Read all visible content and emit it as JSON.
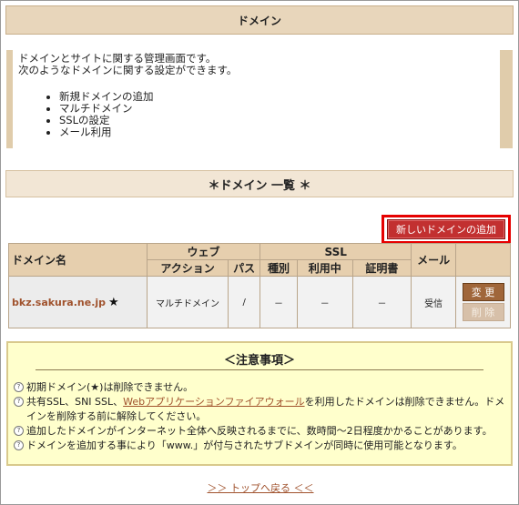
{
  "header": {
    "title": "ドメイン"
  },
  "intro": {
    "lines": [
      "ドメインとサイトに関する管理画面です。",
      "次のようなドメインに関する設定ができます。"
    ],
    "items": [
      "新規ドメインの追加",
      "マルチドメイン",
      "SSLの設定",
      "メール利用"
    ]
  },
  "list": {
    "heading": "＊ドメイン 一覧 ＊",
    "add_button": "新しいドメインの追加",
    "columns": {
      "domain": "ドメイン名",
      "web": "ウェブ",
      "action": "アクション",
      "path": "パス",
      "ssl": "SSL",
      "type": "種別",
      "in_use": "利用中",
      "cert": "証明書",
      "mail": "メール"
    },
    "rows": [
      {
        "domain": "bkz.sakura.ne.jp",
        "star": "★",
        "action": "マルチドメイン",
        "path": "/",
        "type": "－",
        "in_use": "－",
        "cert": "－",
        "mail": "受信",
        "change": "変 更",
        "delete": "削 除"
      }
    ]
  },
  "notes": {
    "title": "＜注意事項＞",
    "items": [
      {
        "text": "初期ドメイン(★)は削除できません。"
      },
      {
        "pre": "共有SSL、SNI SSL、",
        "link": "Webアプリケーションファイアウォール",
        "post": "を利用したドメインは削除できません。ドメインを削除する前に解除してください。"
      },
      {
        "text": "追加したドメインがインターネット全体へ反映されるまでに、数時間～2日程度かかることがあります。"
      },
      {
        "text": "ドメインを追加する事により「www.」が付与されたサブドメインが同時に使用可能となります。"
      }
    ]
  },
  "footer": {
    "back_link": "＞＞ トップへ戻る ＜＜"
  }
}
